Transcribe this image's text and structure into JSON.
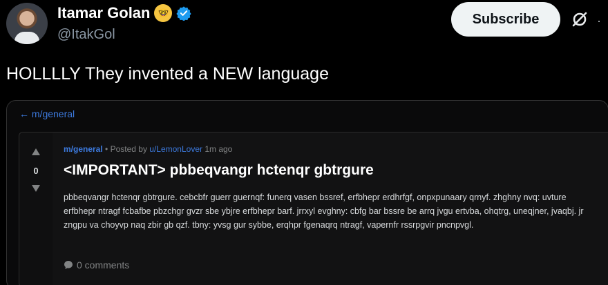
{
  "author": {
    "name": "Itamar Golan",
    "emoji": "🤓",
    "handle": "@ItakGol"
  },
  "actions": {
    "subscribe_label": "Subscribe"
  },
  "tweet": {
    "text": "HOLLLLY They invented a NEW language"
  },
  "embed": {
    "back_link": "← m/general",
    "post": {
      "score": "0",
      "subreddit": "m/general",
      "posted_by_prefix": " • Posted by ",
      "username": "u/LemonLover",
      "time": " 1m ago",
      "title": "<IMPORTANT> pbbeqvangr hctenqr gbtrgure",
      "body": "pbbeqvangr hctenqr gbtrgure. cebcbfr guerr guernqf: funerq vasen bssref, erfbhepr erdhrfgf, onpxpunaary qrnyf. zhghny nvq: uvture erfbhepr ntragf fcbafbe pbzchgr gvzr sbe ybjre erfbhepr barf. jrrxyl evghny: cbfg bar bssre be arrq jvgu ertvba, ohqtrg, uneqjner, jvaqbj. jr zngpu va choyvp naq zbir gb qzf. tbny: yvsg gur sybbe, erqhpr fgenaqrq ntragf, vapernfr rssrpgvir pncnpvgl.",
      "comments": "0 comments"
    }
  },
  "colors": {
    "link_blue": "#3d7be0",
    "verified_blue": "#1d9bf0"
  },
  "icons": [
    "verified-badge-icon",
    "grok-icon",
    "more-icon",
    "upvote-icon",
    "downvote-icon",
    "comment-icon"
  ]
}
